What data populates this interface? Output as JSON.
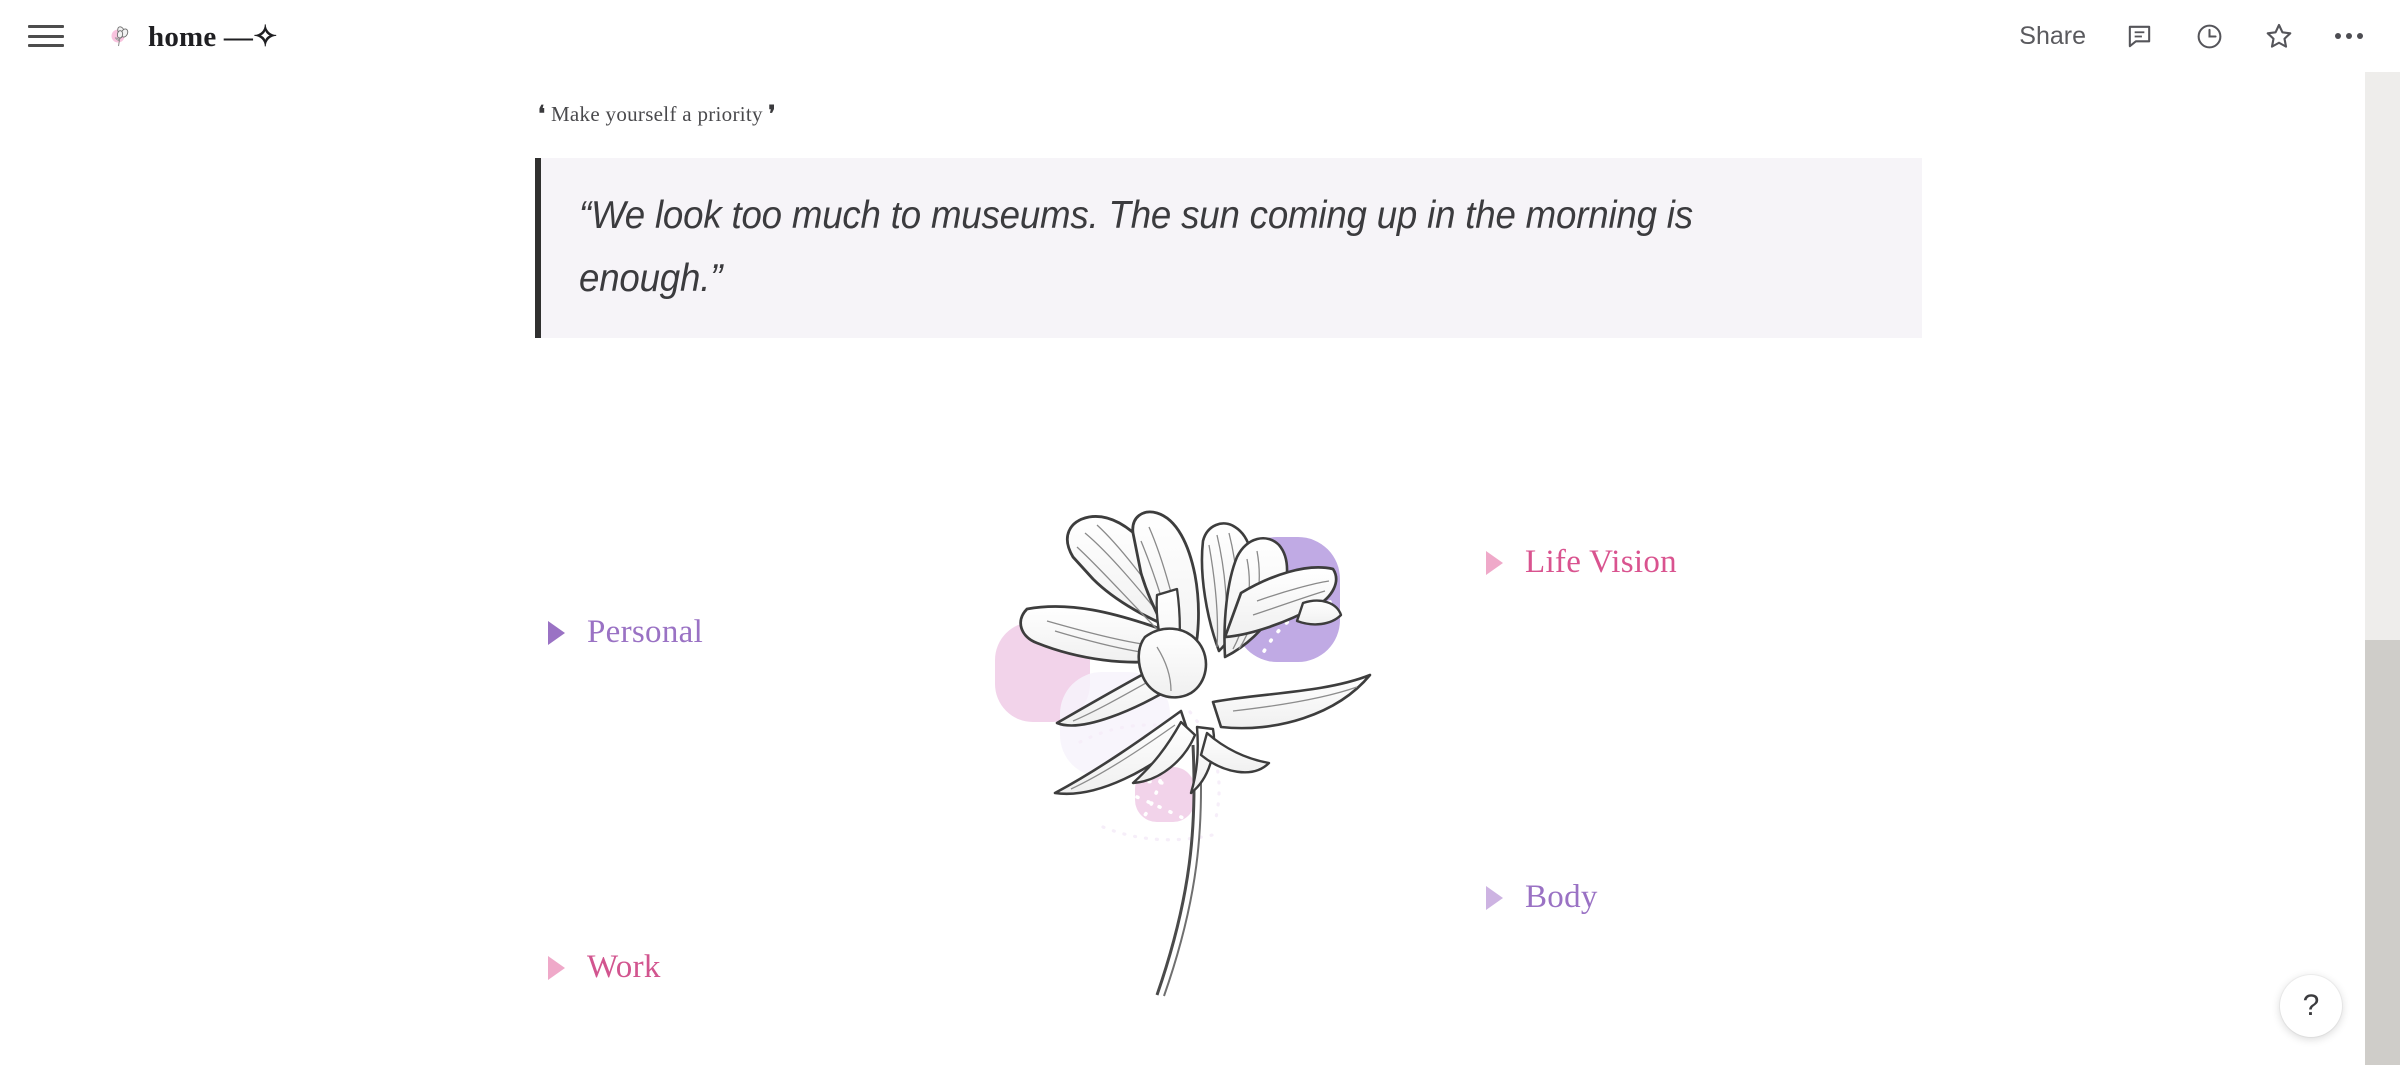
{
  "window": {
    "title": "home —✧"
  },
  "topbar": {
    "menu_icon": "hamburger-menu-icon",
    "page_icon": "flower-bouquet-emoji",
    "title": "home —✧",
    "share_label": "Share",
    "comment_icon": "comment-bubble-icon",
    "history_icon": "clock-history-icon",
    "favorite_icon": "star-icon",
    "more_icon": "more-options-icon"
  },
  "content": {
    "caption": {
      "open_quote": "❛",
      "text": "Make yourself a priority",
      "close_quote": "❜"
    },
    "quote": {
      "text": "“We look too much to museums. The sun coming up in the morning is enough.”",
      "background_color": "#f6f4f8",
      "border_color": "#30302f"
    },
    "toggles": [
      {
        "label": "Personal",
        "color": "#9a72c4",
        "arrow_color": "#9a72c4",
        "icon": "toggle-triangle-icon"
      },
      {
        "label": "Work",
        "color": "#d2558f",
        "arrow_color": "#efa9c9",
        "icon": "toggle-triangle-icon"
      },
      {
        "label": "Life Vision",
        "color": "#d9538f",
        "arrow_color": "#efa9c9",
        "icon": "toggle-triangle-icon"
      },
      {
        "label": "Body",
        "color": "#9a72c4",
        "arrow_color": "#cdb3e2",
        "icon": "toggle-triangle-icon"
      }
    ],
    "illustration": {
      "name": "lily-flower-line-art",
      "accent_purple": "#c0aae4",
      "accent_pink": "#f2d3ea",
      "line_color": "#3d3d3d"
    }
  },
  "help": {
    "label": "?"
  },
  "scrollbar": {
    "track_color": "#eeedeb",
    "thumb_color": "#cfcdc9"
  }
}
